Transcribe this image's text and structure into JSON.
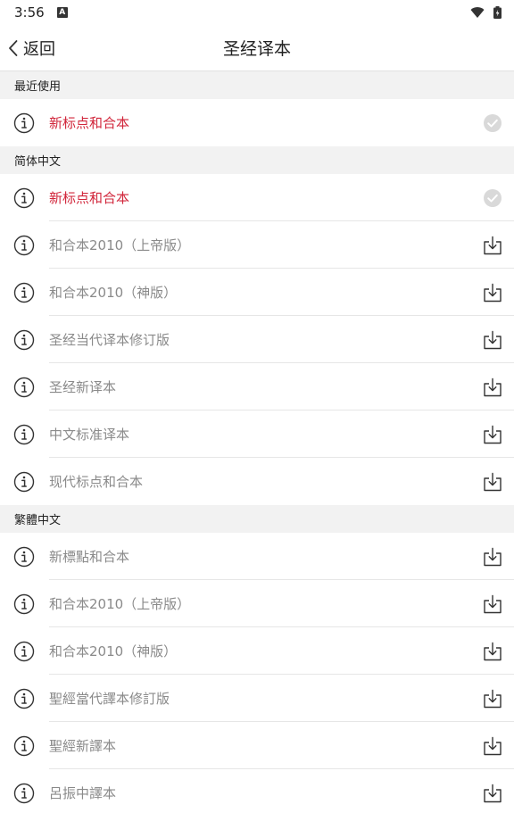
{
  "status": {
    "time": "3:56",
    "notification_badge": "A"
  },
  "nav": {
    "back_label": "返回",
    "title": "圣经译本"
  },
  "colors": {
    "active": "#d1253a",
    "inactive_text": "#8a8a8a",
    "section_bg": "#f2f2f2"
  },
  "sections": [
    {
      "header": "最近使用",
      "items": [
        {
          "label": "新标点和合本",
          "status": "selected"
        }
      ]
    },
    {
      "header": "简体中文",
      "items": [
        {
          "label": "新标点和合本",
          "status": "selected"
        },
        {
          "label": "和合本2010（上帝版）",
          "status": "download"
        },
        {
          "label": "和合本2010（神版）",
          "status": "download"
        },
        {
          "label": "圣经当代译本修订版",
          "status": "download"
        },
        {
          "label": "圣经新译本",
          "status": "download"
        },
        {
          "label": "中文标准译本",
          "status": "download"
        },
        {
          "label": "现代标点和合本",
          "status": "download"
        }
      ]
    },
    {
      "header": "繁體中文",
      "items": [
        {
          "label": "新標點和合本",
          "status": "download"
        },
        {
          "label": "和合本2010（上帝版）",
          "status": "download"
        },
        {
          "label": "和合本2010（神版）",
          "status": "download"
        },
        {
          "label": "聖經當代譯本修訂版",
          "status": "download"
        },
        {
          "label": "聖經新譯本",
          "status": "download"
        },
        {
          "label": "呂振中譯本",
          "status": "download"
        }
      ]
    }
  ]
}
